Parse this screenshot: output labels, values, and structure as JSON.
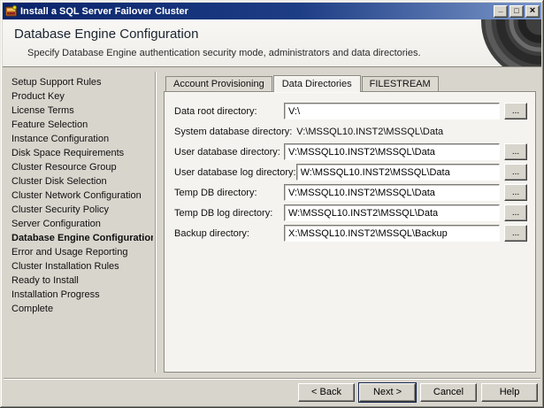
{
  "window": {
    "title": "Install a SQL Server Failover Cluster",
    "controls": {
      "minimize": "_",
      "maximize": "□",
      "close": "×"
    }
  },
  "colors": {
    "titlebar_start": "#0a246a",
    "titlebar_end": "#7a96c8",
    "dialog_bg": "#d8d5cd",
    "panel_bg": "#f4f3ef",
    "header_bg": "#efeee9",
    "title_text": "#1a2430"
  },
  "header": {
    "title": "Database Engine Configuration",
    "subtitle": "Specify Database Engine authentication security mode, administrators and data directories."
  },
  "sidebar": {
    "items": [
      {
        "label": "Setup Support Rules",
        "current": false
      },
      {
        "label": "Product Key",
        "current": false
      },
      {
        "label": "License Terms",
        "current": false
      },
      {
        "label": "Feature Selection",
        "current": false
      },
      {
        "label": "Instance Configuration",
        "current": false
      },
      {
        "label": "Disk Space Requirements",
        "current": false
      },
      {
        "label": "Cluster Resource Group",
        "current": false
      },
      {
        "label": "Cluster Disk Selection",
        "current": false
      },
      {
        "label": "Cluster Network Configuration",
        "current": false
      },
      {
        "label": "Cluster Security Policy",
        "current": false
      },
      {
        "label": "Server Configuration",
        "current": false
      },
      {
        "label": "Database Engine Configuration",
        "current": true
      },
      {
        "label": "Error and Usage Reporting",
        "current": false
      },
      {
        "label": "Cluster Installation Rules",
        "current": false
      },
      {
        "label": "Ready to Install",
        "current": false
      },
      {
        "label": "Installation Progress",
        "current": false
      },
      {
        "label": "Complete",
        "current": false
      }
    ]
  },
  "tabs": [
    {
      "label": "Account Provisioning",
      "active": false
    },
    {
      "label": "Data Directories",
      "active": true
    },
    {
      "label": "FILESTREAM",
      "active": false
    }
  ],
  "browse_label": "...",
  "fields": [
    {
      "label": "Data root directory:",
      "value": "V:\\",
      "editable": true,
      "has_browse": true
    },
    {
      "label": "System database directory:",
      "value": "V:\\MSSQL10.INST2\\MSSQL\\Data",
      "editable": false,
      "has_browse": false
    },
    {
      "label": "User database directory:",
      "value": "V:\\MSSQL10.INST2\\MSSQL\\Data",
      "editable": true,
      "has_browse": true
    },
    {
      "label": "User database log directory:",
      "value": "W:\\MSSQL10.INST2\\MSSQL\\Data",
      "editable": true,
      "has_browse": true
    },
    {
      "label": "Temp DB directory:",
      "value": "V:\\MSSQL10.INST2\\MSSQL\\Data",
      "editable": true,
      "has_browse": true
    },
    {
      "label": "Temp DB log directory:",
      "value": "W:\\MSSQL10.INST2\\MSSQL\\Data",
      "editable": true,
      "has_browse": true
    },
    {
      "label": "Backup directory:",
      "value": "X:\\MSSQL10.INST2\\MSSQL\\Backup",
      "editable": true,
      "has_browse": true
    }
  ],
  "footer": {
    "buttons": [
      {
        "label": "< Back",
        "name": "back-button",
        "default": false
      },
      {
        "label": "Next >",
        "name": "next-button",
        "default": true
      },
      {
        "label": "Cancel",
        "name": "cancel-button",
        "default": false
      },
      {
        "label": "Help",
        "name": "help-button",
        "default": false
      }
    ]
  }
}
